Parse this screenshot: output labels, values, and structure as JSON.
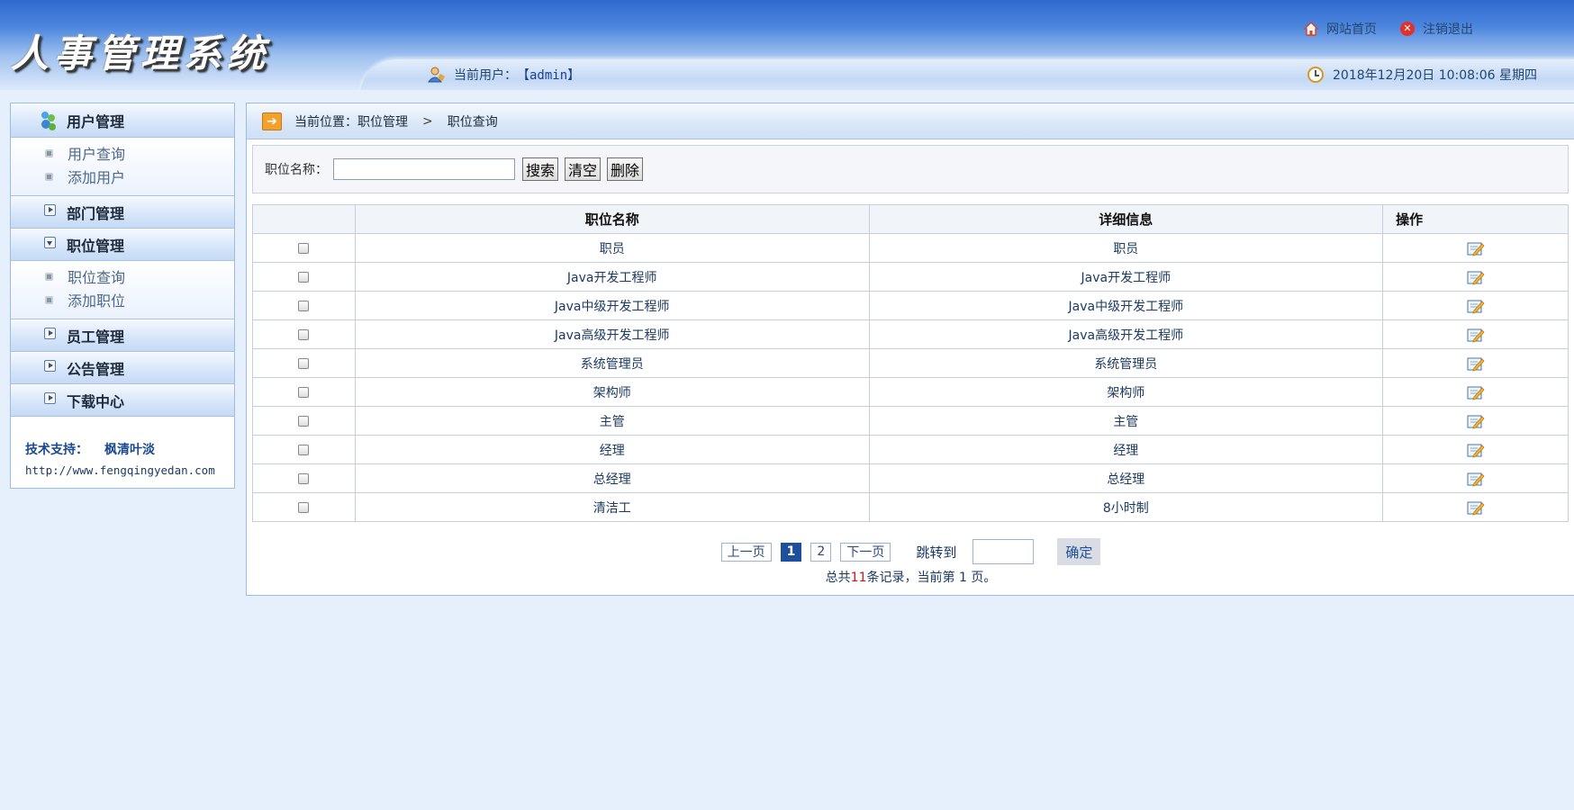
{
  "header": {
    "logo_text": "人事管理系统",
    "home_link": "网站首页",
    "logout_link": "注销退出",
    "user_label": "当前用户：",
    "user_name": "【admin】",
    "datetime": "2018年12月20日 10:08:06 星期四"
  },
  "sidebar": {
    "menus": [
      {
        "label": "用户管理",
        "expanded": true,
        "items": [
          "用户查询",
          "添加用户"
        ]
      },
      {
        "label": "部门管理",
        "expanded": false
      },
      {
        "label": "职位管理",
        "expanded": true,
        "items": [
          "职位查询",
          "添加职位"
        ]
      },
      {
        "label": "员工管理",
        "expanded": false
      },
      {
        "label": "公告管理",
        "expanded": false
      },
      {
        "label": "下载中心",
        "expanded": false
      }
    ],
    "support_label": "技术支持：",
    "support_name": "枫清叶淡",
    "support_url": "http://www.fengqingyedan.com"
  },
  "breadcrumb": {
    "prefix": "当前位置：职位管理",
    "separator": ">",
    "current": "职位查询"
  },
  "search": {
    "label": "职位名称：",
    "value": "",
    "buttons": [
      "搜索",
      "清空",
      "删除"
    ]
  },
  "table": {
    "headers": [
      "",
      "职位名称",
      "详细信息",
      "操作"
    ],
    "rows": [
      [
        "职员",
        "职员"
      ],
      [
        "Java开发工程师",
        "Java开发工程师"
      ],
      [
        "Java中级开发工程师",
        "Java中级开发工程师"
      ],
      [
        "Java高级开发工程师",
        "Java高级开发工程师"
      ],
      [
        "系统管理员",
        "系统管理员"
      ],
      [
        "架构师",
        "架构师"
      ],
      [
        "主管",
        "主管"
      ],
      [
        "经理",
        "经理"
      ],
      [
        "总经理",
        "总经理"
      ],
      [
        "清洁工",
        "8小时制"
      ]
    ]
  },
  "pager": {
    "prev": "上一页",
    "pages": [
      "1",
      "2"
    ],
    "current": "1",
    "next": "下一页",
    "jump_label": "跳转到",
    "confirm": "确定",
    "info_prefix": "总共",
    "total": "11",
    "info_middle": "条记录，当前第 ",
    "current_page": "1",
    "info_suffix": " 页。"
  },
  "colors": {
    "header_blue": "#2f6ad0",
    "page_bg": "#e6f0fc",
    "link_text": "#1c3a62",
    "pager_current": "#1e4f9c",
    "total_red": "#d8141b"
  }
}
